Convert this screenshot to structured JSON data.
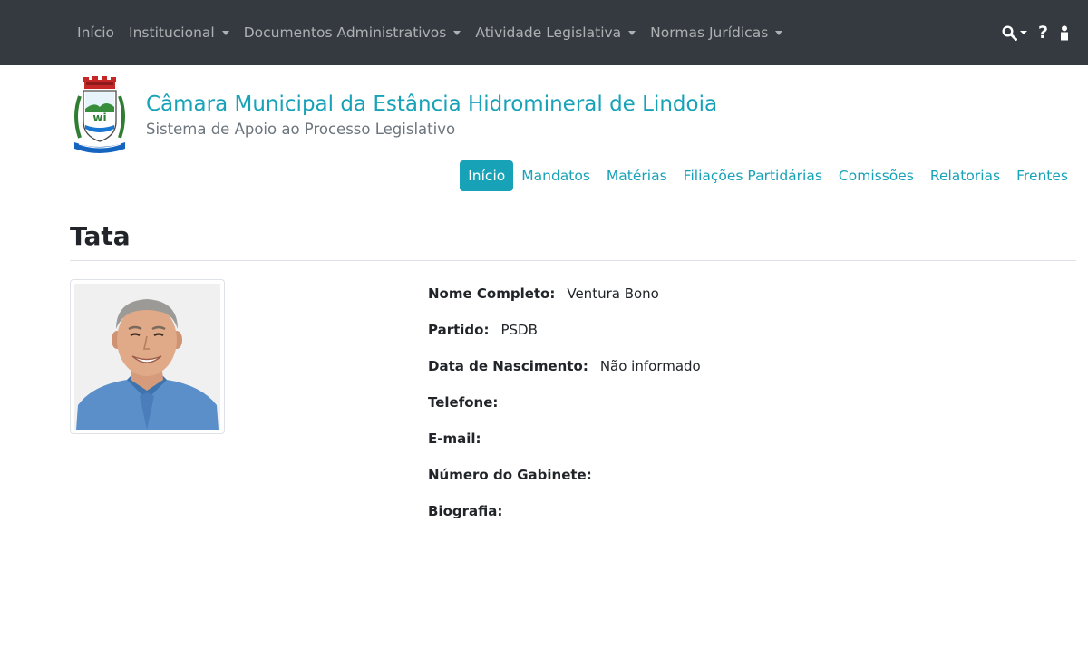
{
  "topnav": {
    "items": [
      {
        "label": "Início",
        "dropdown": false
      },
      {
        "label": "Institucional",
        "dropdown": true
      },
      {
        "label": "Documentos Administrativos",
        "dropdown": true
      },
      {
        "label": "Atividade Legislativa",
        "dropdown": true
      },
      {
        "label": "Normas Jurídicas",
        "dropdown": true
      }
    ],
    "right_icons": [
      "search-icon",
      "help-icon",
      "user-icon"
    ],
    "help_label": "?",
    "background": "#343a40"
  },
  "header": {
    "title": "Câmara Municipal da Estância Hidromineral de Lindoia",
    "subtitle": "Sistema de Apoio ao Processo Legislativo",
    "logo_icon": "municipal-coat-of-arms-icon",
    "accent": "#17a2b8"
  },
  "subnav": {
    "items": [
      {
        "label": "Início",
        "active": true
      },
      {
        "label": "Mandatos",
        "active": false
      },
      {
        "label": "Matérias",
        "active": false
      },
      {
        "label": "Filiações Partidárias",
        "active": false
      },
      {
        "label": "Comissões",
        "active": false
      },
      {
        "label": "Relatorias",
        "active": false
      },
      {
        "label": "Frentes",
        "active": false
      }
    ]
  },
  "page": {
    "title": "Tata"
  },
  "profile": {
    "photo_icon": "parliamentarian-photo",
    "fields": [
      {
        "label": "Nome Completo:",
        "value": "Ventura Bono"
      },
      {
        "label": "Partido:",
        "value": "PSDB"
      },
      {
        "label": "Data de Nascimento:",
        "value": "Não informado"
      },
      {
        "label": "Telefone:",
        "value": ""
      },
      {
        "label": "E-mail:",
        "value": ""
      },
      {
        "label": "Número do Gabinete:",
        "value": ""
      },
      {
        "label": "Biografia:",
        "value": ""
      }
    ]
  }
}
